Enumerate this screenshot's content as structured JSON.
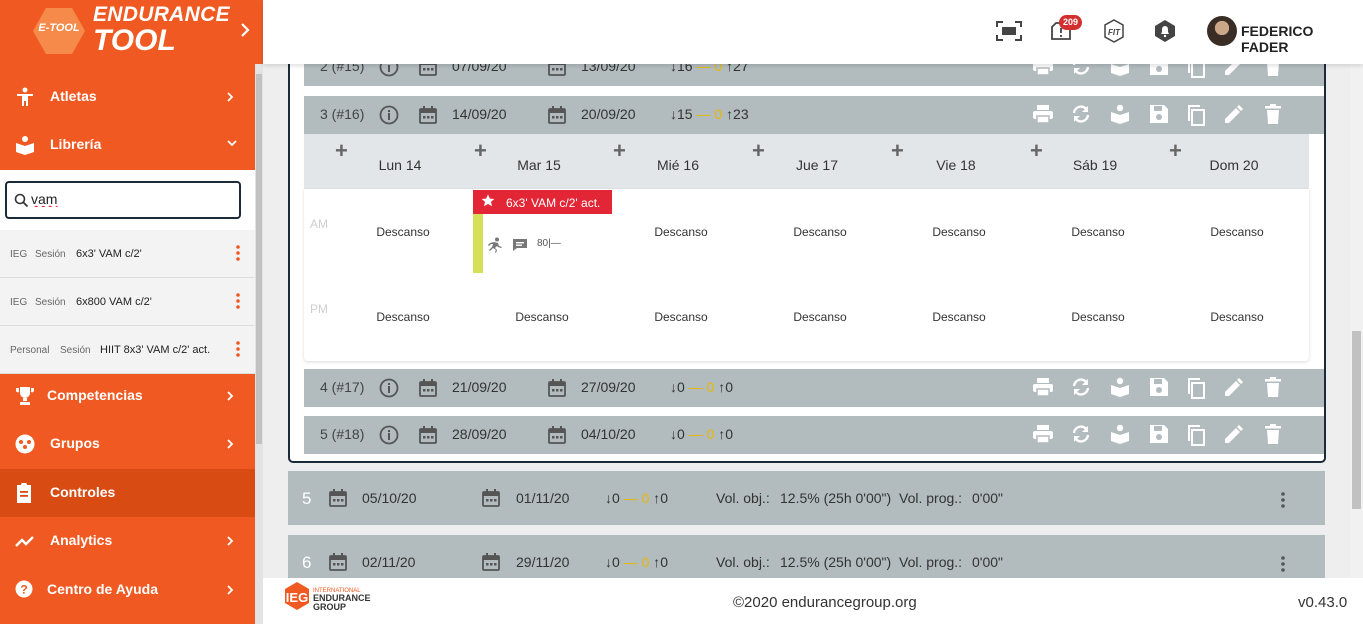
{
  "brand": {
    "hex_text": "E-TOOL",
    "line1": "ENDURANCE",
    "line2": "TOOL"
  },
  "sidebar": {
    "items": [
      {
        "label": "Atletas"
      },
      {
        "label": "Librería"
      },
      {
        "label": "Competencias"
      },
      {
        "label": "Grupos"
      },
      {
        "label": "Controles"
      },
      {
        "label": "Analytics"
      },
      {
        "label": "Centro de Ayuda"
      }
    ],
    "search_value": "vam",
    "results": [
      {
        "owner": "IEG",
        "kind": "Sesión",
        "name": "6x3' VAM c/2'"
      },
      {
        "owner": "IEG",
        "kind": "Sesión",
        "name": "6x800 VAM c/2'"
      },
      {
        "owner": "Personal",
        "kind": "Sesión",
        "name": "HIIT 8x3' VAM c/2' act."
      }
    ]
  },
  "header": {
    "badge_count": "209",
    "fit_label": "FIT",
    "user_name": "FEDERICO FADER"
  },
  "weeks": [
    {
      "label": "2 (#15)",
      "start": "07/09/20",
      "end": "13/09/20",
      "down": "16",
      "mid": "0",
      "up": "27"
    },
    {
      "label": "3 (#16)",
      "start": "14/09/20",
      "end": "20/09/20",
      "down": "15",
      "mid": "0",
      "up": "23"
    },
    {
      "label": "4 (#17)",
      "start": "21/09/20",
      "end": "27/09/20",
      "down": "0",
      "mid": "0",
      "up": "0"
    },
    {
      "label": "5 (#18)",
      "start": "28/09/20",
      "end": "04/10/20",
      "down": "0",
      "mid": "0",
      "up": "0"
    }
  ],
  "calendar": {
    "days": [
      "Lun 14",
      "Mar 15",
      "Mié 16",
      "Jue 17",
      "Vie 18",
      "Sáb 19",
      "Dom 20"
    ],
    "am_label": "AM",
    "pm_label": "PM",
    "rest": "Descanso",
    "session": {
      "title": "6x3' VAM c/2' act.",
      "metric": "80|—"
    }
  },
  "phases": [
    {
      "num": "5",
      "start": "05/10/20",
      "end": "01/11/20",
      "down": "0",
      "mid": "0",
      "up": "0",
      "vol_obj_label": "Vol. obj.:",
      "vol_obj": "12.5% (25h 0'00\")",
      "vol_prog_label": "Vol. prog.:",
      "vol_prog": "0'00\""
    },
    {
      "num": "6",
      "start": "02/11/20",
      "end": "29/11/20",
      "down": "0",
      "mid": "0",
      "up": "0",
      "vol_obj_label": "Vol. obj.:",
      "vol_obj": "12.5% (25h 0'00\")",
      "vol_prog_label": "Vol. prog.:",
      "vol_prog": "0'00\""
    }
  ],
  "footer": {
    "logo_text": "IEG",
    "logo_sub1": "INTERNATIONAL",
    "logo_sub2": "ENDURANCE",
    "logo_sub3": "GROUP",
    "copyright": "©2020 endurancegroup.org",
    "version": "v0.43.0"
  },
  "colors": {
    "brand_orange": "#f05a22",
    "week_bar": "#b2bcbf",
    "session_red": "#e32636",
    "session_bar": "#d7df5a",
    "arrow_yellow": "#e8b800"
  }
}
